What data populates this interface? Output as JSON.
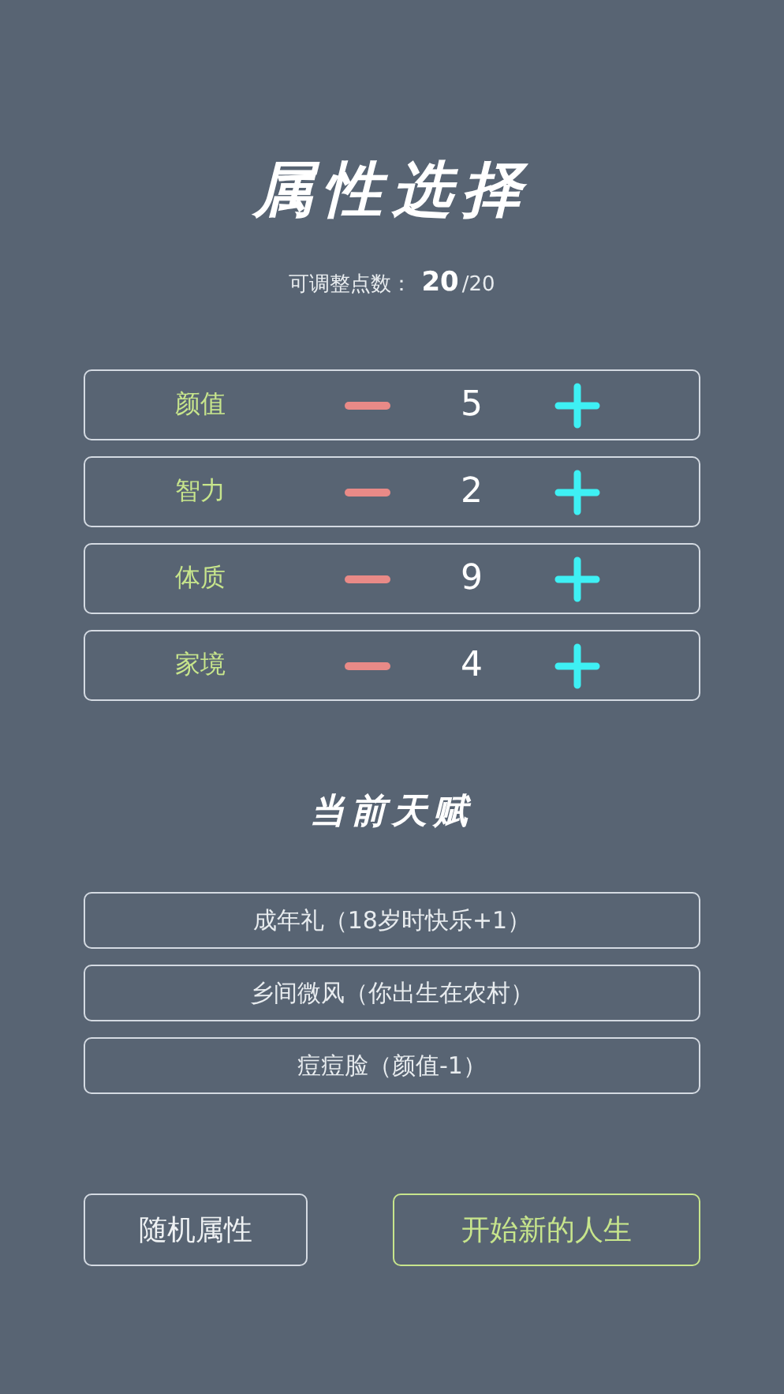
{
  "title": "属性选择",
  "points": {
    "label": "可调整点数：",
    "value": "20",
    "total": "/20"
  },
  "attributes": [
    {
      "name": "颜值",
      "value": "5"
    },
    {
      "name": "智力",
      "value": "2"
    },
    {
      "name": "体质",
      "value": "9"
    },
    {
      "name": "家境",
      "value": "4"
    }
  ],
  "talents_title": "当前天赋",
  "talents": [
    "成年礼（18岁时快乐+1）",
    "乡间微风（你出生在农村）",
    "痘痘脸（颜值-1）"
  ],
  "buttons": [
    {
      "label": "随机属性",
      "kind": "default"
    },
    {
      "label": "开始新的人生",
      "kind": "primary"
    }
  ]
}
